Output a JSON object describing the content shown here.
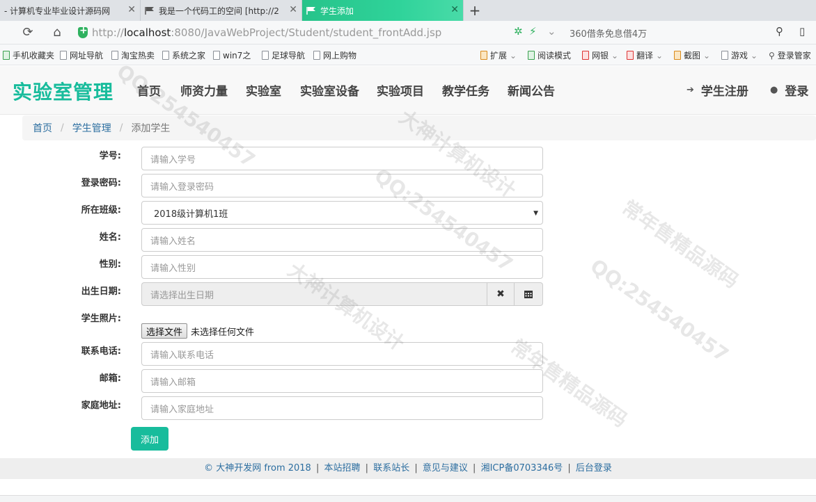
{
  "browser": {
    "tabs": [
      {
        "title": "- 计算机专业毕业设计源码网",
        "active": false
      },
      {
        "title": "我是一个代码工的空间 [http://2",
        "active": false
      },
      {
        "title": "学生添加",
        "active": true
      }
    ],
    "new_tab": "+",
    "url_prefix": "http://",
    "url_host": "localhost",
    "url_rest": ":8080/JavaWebProject/Student/student_frontAdd.jsp",
    "ad_text": "360借条免息借4万",
    "bookmarks": [
      "手机收藏夹",
      "网址导航",
      "淘宝热卖",
      "系统之家",
      "win7之",
      "足球导航",
      "网上购物"
    ],
    "right_tools": [
      "扩展",
      "阅读模式",
      "网银",
      "翻译",
      "截图",
      "游戏",
      "登录管家"
    ]
  },
  "site": {
    "logo": "实验室管理",
    "nav": [
      "首页",
      "师资力量",
      "实验室",
      "实验室设备",
      "实验项目",
      "教学任务",
      "新闻公告"
    ],
    "register": "学生注册",
    "login": "登录"
  },
  "breadcrumb": {
    "home": "首页",
    "section": "学生管理",
    "current": "添加学生",
    "separator": "/"
  },
  "form": {
    "student_no": {
      "label": "学号:",
      "placeholder": "请输入学号"
    },
    "password": {
      "label": "登录密码:",
      "placeholder": "请输入登录密码"
    },
    "class": {
      "label": "所在班级:",
      "selected": "2018级计算机1班"
    },
    "name": {
      "label": "姓名:",
      "placeholder": "请输入姓名"
    },
    "gender": {
      "label": "性别:",
      "placeholder": "请输入性别"
    },
    "birthday": {
      "label": "出生日期:",
      "placeholder": "请选择出生日期"
    },
    "photo": {
      "label": "学生照片:",
      "button": "选择文件",
      "status": "未选择任何文件"
    },
    "phone": {
      "label": "联系电话:",
      "placeholder": "请输入联系电话"
    },
    "email": {
      "label": "邮箱:",
      "placeholder": "请输入邮箱"
    },
    "address": {
      "label": "家庭地址:",
      "placeholder": "请输入家庭地址"
    },
    "submit": "添加"
  },
  "footer": {
    "copyright": "© 大神开发网 from 2018",
    "links": [
      "本站招聘",
      "联系站长",
      "意见与建议",
      "湘ICP备0703346号",
      "后台登录"
    ]
  },
  "watermark": {
    "texts": [
      "QQ:254540457",
      "大神计算机设计",
      "常年售精品源码"
    ]
  },
  "colors": {
    "brand": "#18bc9c",
    "link": "#2c6ea0",
    "active_tab": "#2fd39a"
  }
}
